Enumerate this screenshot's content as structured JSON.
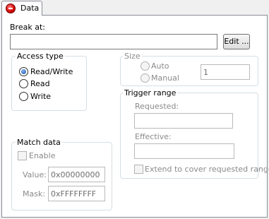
{
  "tabs": [
    {
      "label": "Data",
      "icon": "stop-icon"
    }
  ],
  "break_at": {
    "label": "Break at:",
    "value": "",
    "edit_button": "Edit ..."
  },
  "access_type": {
    "title": "Access type",
    "options": [
      {
        "label": "Read/Write",
        "checked": true
      },
      {
        "label": "Read",
        "checked": false
      },
      {
        "label": "Write",
        "checked": false
      }
    ]
  },
  "size": {
    "title": "Size",
    "options": [
      {
        "label": "Auto",
        "checked": false
      },
      {
        "label": "Manual",
        "checked": false
      }
    ],
    "value": "1"
  },
  "trigger_range": {
    "title": "Trigger range",
    "requested_label": "Requested:",
    "requested_value": "",
    "effective_label": "Effective:",
    "effective_value": "",
    "extend_label": "Extend to cover requested range",
    "extend_checked": false
  },
  "match_data": {
    "title": "Match data",
    "enable_label": "Enable",
    "enable_checked": false,
    "value_label": "Value:",
    "value": "0x00000000",
    "mask_label": "Mask:",
    "mask": "0xFFFFFFFF"
  },
  "colors": {
    "panel_border": "#898c95",
    "group_border": "#d5dfe5",
    "disabled_text": "#8a8a8a",
    "radio_selected": "#1c4f9c"
  }
}
